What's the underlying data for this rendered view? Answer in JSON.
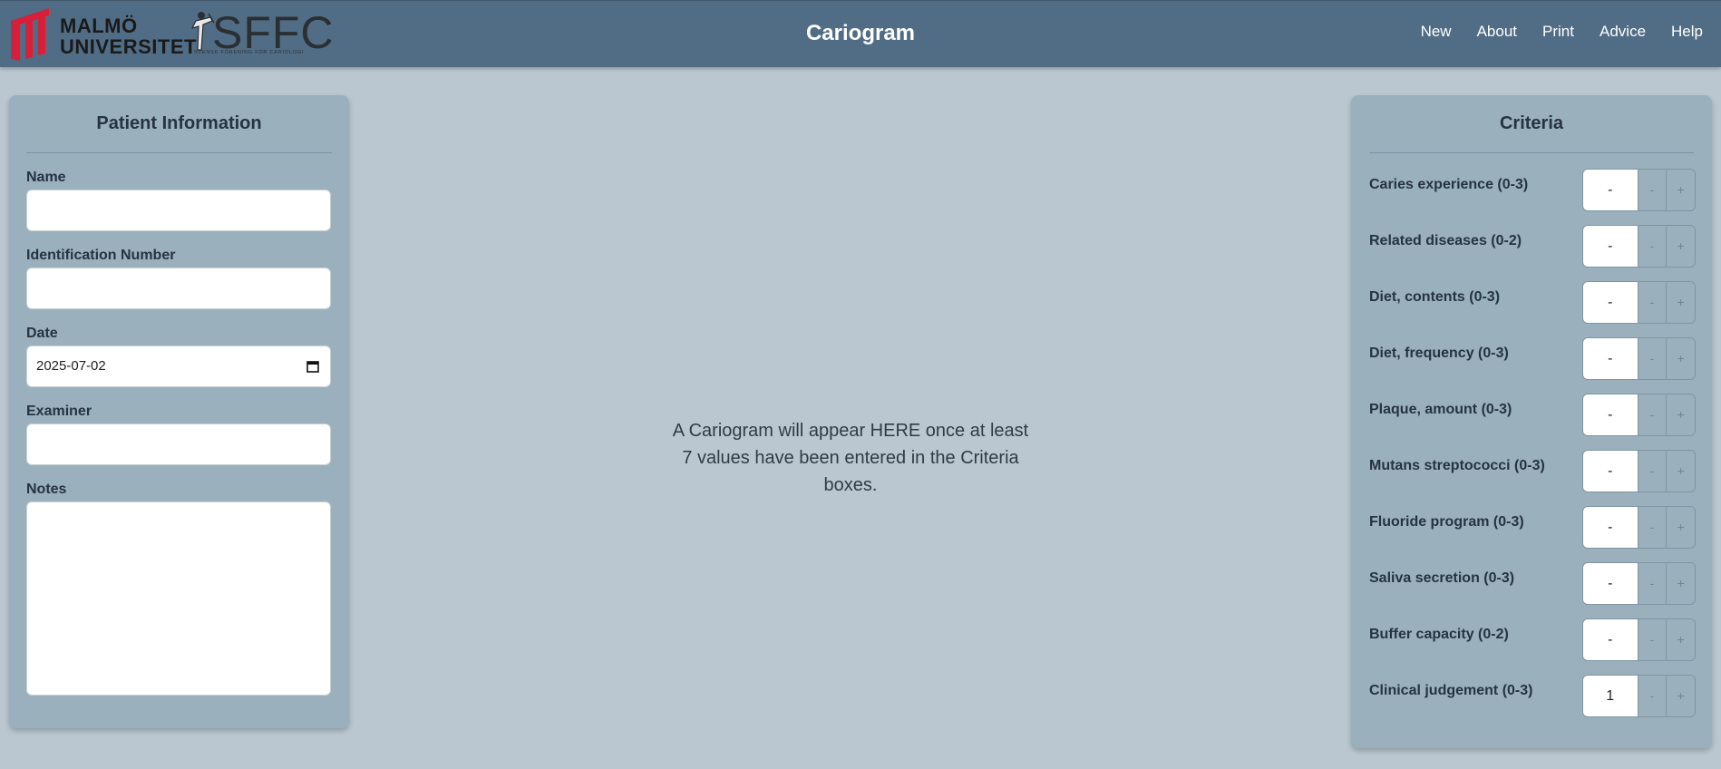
{
  "header": {
    "brand_university": "MALMÖ\nUNIVERSITET",
    "brand_sffc": "SFFC",
    "brand_sffc_tagline": "SVENSK FÖRENING FÖR CARIOLOGI",
    "title": "Cariogram",
    "nav": [
      "New",
      "About",
      "Print",
      "Advice",
      "Help"
    ]
  },
  "patient": {
    "title": "Patient Information",
    "name_label": "Name",
    "name_value": "",
    "id_label": "Identification Number",
    "id_value": "",
    "date_label": "Date",
    "date_value": "2025-07-02",
    "examiner_label": "Examiner",
    "examiner_value": "",
    "notes_label": "Notes",
    "notes_value": ""
  },
  "main": {
    "placeholder_line1": "A Cariogram will appear HERE once at least",
    "placeholder_line2": "7 values have been entered in the Criteria",
    "placeholder_line3": "boxes."
  },
  "criteria": {
    "title": "Criteria",
    "decrement_label": "-",
    "increment_label": "+",
    "items": [
      {
        "label": "Caries experience (0-3)",
        "value": "-"
      },
      {
        "label": "Related diseases (0-2)",
        "value": "-"
      },
      {
        "label": "Diet, contents (0-3)",
        "value": "-"
      },
      {
        "label": "Diet, frequency (0-3)",
        "value": "-"
      },
      {
        "label": "Plaque, amount (0-3)",
        "value": "-"
      },
      {
        "label": "Mutans streptococci (0-3)",
        "value": "-"
      },
      {
        "label": "Fluoride program (0-3)",
        "value": "-"
      },
      {
        "label": "Saliva secretion (0-3)",
        "value": "-"
      },
      {
        "label": "Buffer capacity (0-2)",
        "value": "-"
      },
      {
        "label": "Clinical judgement (0-3)",
        "value": "1"
      }
    ]
  },
  "colors": {
    "header_bg": "#516d85",
    "page_bg": "#bac7d0",
    "panel_bg": "#9ab0bd",
    "brand_red": "#d6203a"
  }
}
